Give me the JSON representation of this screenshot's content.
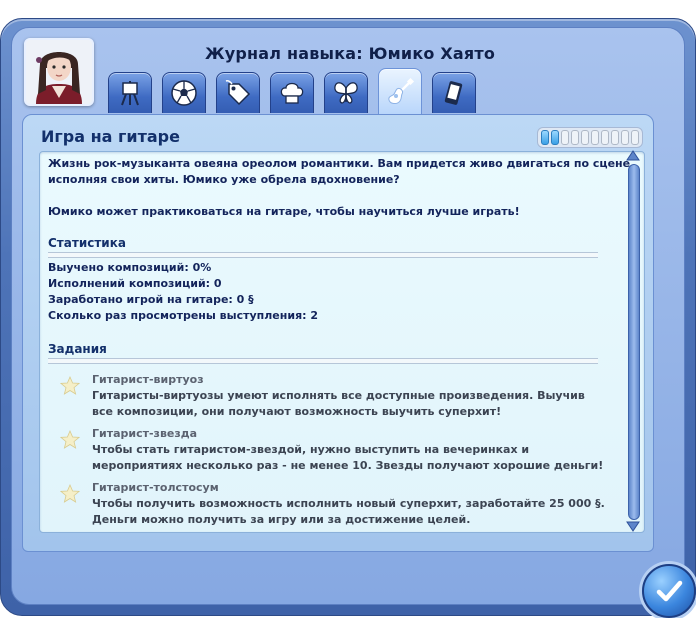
{
  "header": {
    "title": "Журнал навыка: Юмико Хаято"
  },
  "tabs": [
    {
      "icon": "easel-icon",
      "active": false
    },
    {
      "icon": "soccer-ball-icon",
      "active": false
    },
    {
      "icon": "price-tag-icon",
      "active": false
    },
    {
      "icon": "chef-hat-icon",
      "active": false
    },
    {
      "icon": "butterfly-icon",
      "active": false
    },
    {
      "icon": "guitar-icon",
      "active": true
    },
    {
      "icon": "smartphone-icon",
      "active": false
    }
  ],
  "skill": {
    "name": "Игра на гитаре",
    "level": 2,
    "max_level": 10
  },
  "intro": {
    "line1": "Жизнь рок-музыканта овеяна ореолом романтики. Вам придется живо двигаться по сцене,",
    "line2": "исполняя свои хиты. Юмико уже обрела вдохновение?",
    "line3": "Юмико может практиковаться на гитаре, чтобы научиться лучше играть!"
  },
  "stats": {
    "heading": "Статистика",
    "items": [
      "Выучено композиций: 0%",
      "Исполнений композиций: 0",
      "Заработано игрой на гитаре: 0 §",
      "Сколько раз просмотрены выступления: 2"
    ]
  },
  "goals": {
    "heading": "Задания",
    "items": [
      {
        "name": "Гитарист-виртуоз",
        "line1": "Гитаристы-виртуозы умеют исполнять все доступные произведения. Выучив",
        "line2": "все композиции, они получают возможность выучить суперхит!"
      },
      {
        "name": "Гитарист-звезда",
        "line1": "Чтобы стать гитаристом-звездой, нужно выступить на вечеринках и",
        "line2": "мероприятиях несколько раз - не менее 10. Звезды получают хорошие деньги!"
      },
      {
        "name": "Гитарист-толстосум",
        "line1": "Чтобы получить возможность исполнить новый суперхит, заработайте 25 000 §.",
        "line2": "Деньги можно получить за игру или за достижение целей."
      }
    ]
  },
  "colors": {
    "accent": "#3f6bc3",
    "heading": "#13306b"
  }
}
